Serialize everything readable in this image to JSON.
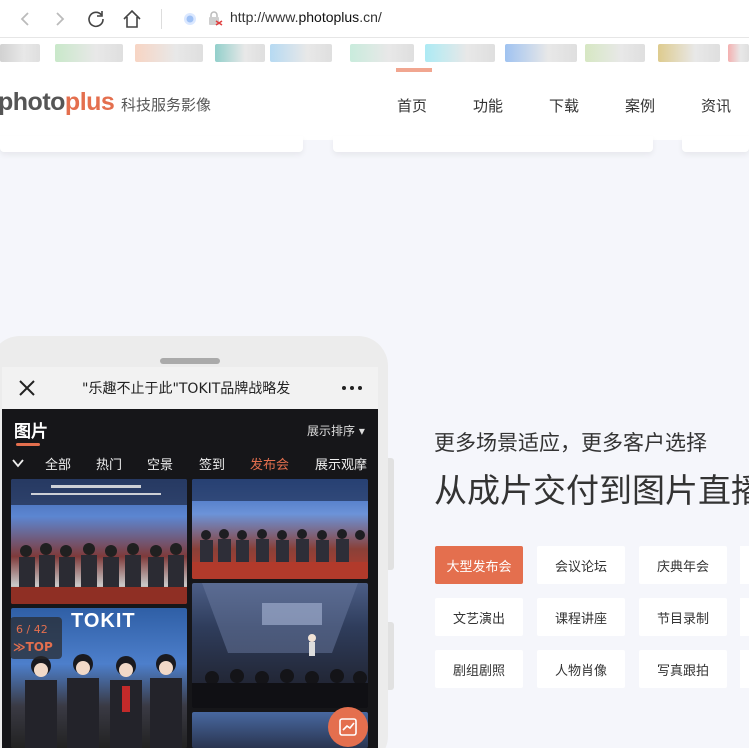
{
  "browser": {
    "url_prefix": "http://www.",
    "url_domain": "photoplus",
    "url_suffix": ".cn/",
    "bookmark_colors": [
      "#c9c9c9",
      "#bfe4c0",
      "#f6cdb9",
      "#7fc7c2",
      "#a9d3f0",
      "#bfe8d6",
      "#9ee7f2",
      "#8fb8ee",
      "#cfe3b8",
      "#d8c27a",
      "#f2a2a2"
    ]
  },
  "site": {
    "logo_part1": "hoto",
    "logo_part2": "plus",
    "logo_lead": "p",
    "tagline": "科技服务影像",
    "nav": [
      "首页",
      "功能",
      "下载",
      "案例",
      "资讯"
    ],
    "accent": "#e46f4e"
  },
  "phone": {
    "title": "\"乐趣不止于此\"TOKIT品牌战略发",
    "tab": "图片",
    "sort_label": "展示排序",
    "categories": [
      "全部",
      "热门",
      "空景",
      "签到",
      "发布会",
      "展示观摩"
    ],
    "active_category": "发布会",
    "photo_count": "6 / 42",
    "top_label": "TOP",
    "brand_text": "TOKIT"
  },
  "main": {
    "subhead": "更多场景适应，更多客户选择",
    "headline": "从成片交付到图片直播",
    "chips": [
      [
        "大型发布会",
        "会议论坛",
        "庆典年会"
      ],
      [
        "文艺演出",
        "课程讲座",
        "节目录制"
      ],
      [
        "剧组剧照",
        "人物肖像",
        "写真跟拍"
      ]
    ],
    "active_chip": "大型发布会"
  }
}
